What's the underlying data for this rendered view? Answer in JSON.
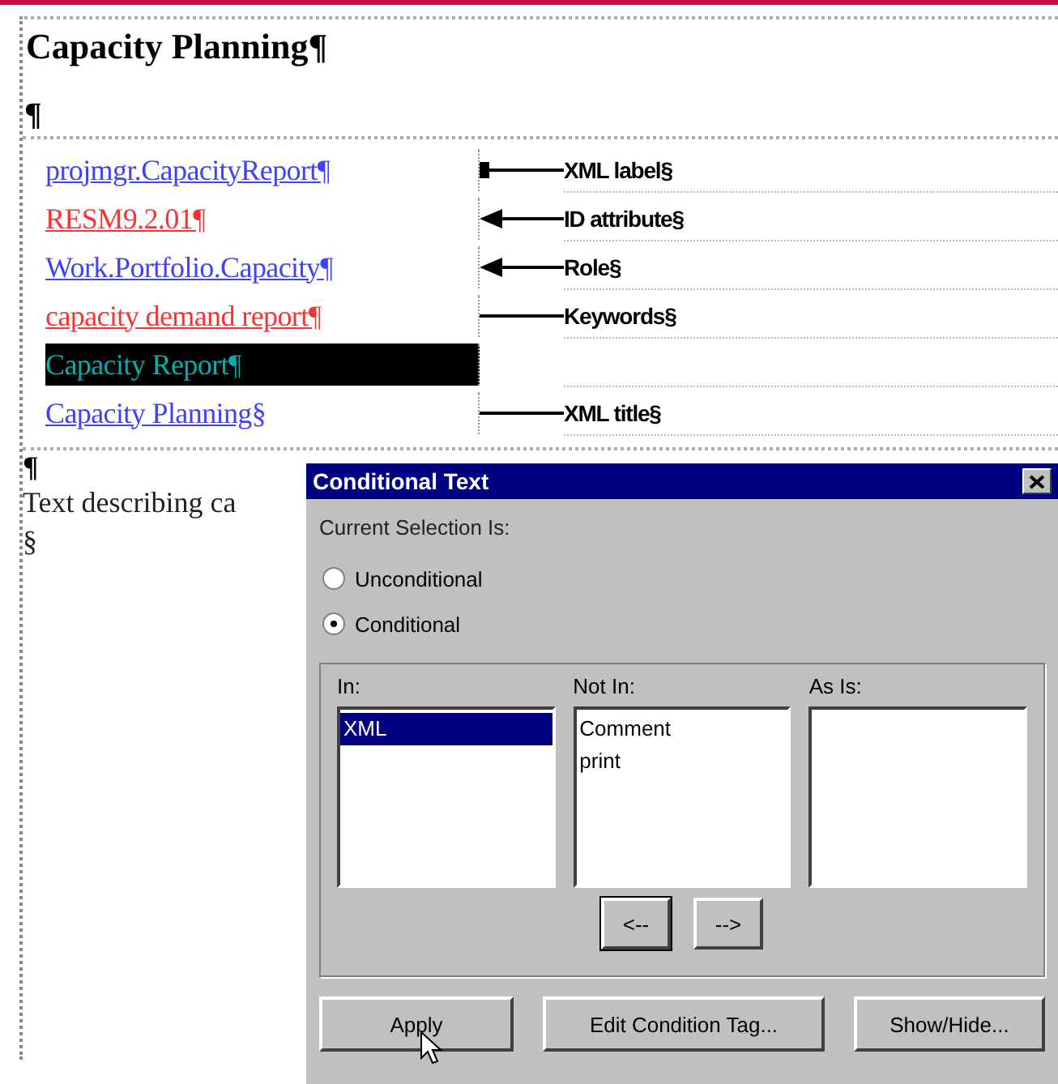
{
  "document": {
    "heading": "Capacity Planning¶",
    "empty_paragraph": "¶",
    "rows": [
      {
        "text": "projmgr.CapacityReport¶",
        "color": "#4040ff",
        "selected": false,
        "label": "XML label§",
        "kind": "dot"
      },
      {
        "text": "RESM9.2.01¶",
        "color": "#ff3030",
        "selected": false,
        "label": "ID attribute§",
        "kind": "arrow"
      },
      {
        "text": "Work.Portfolio.Capacity¶",
        "color": "#4040ff",
        "selected": false,
        "label": "Role§",
        "kind": "arrow"
      },
      {
        "text": "capacity demand report¶",
        "color": "#ff3030",
        "selected": false,
        "label": "Keywords§",
        "kind": "line"
      },
      {
        "text": "Capacity Report¶",
        "color": "#00b0b0",
        "selected": true,
        "label": "",
        "kind": "none"
      },
      {
        "text": "Capacity Planning§",
        "color": "#4040ff",
        "selected": false,
        "label": "XML title§",
        "kind": "line"
      }
    ],
    "after_table_mark": "¶",
    "body_text": "Text describing ca",
    "end_mark": "§"
  },
  "dialog": {
    "title": "Conditional Text",
    "selection_label": "Current Selection Is:",
    "radios": [
      {
        "label": "Unconditional",
        "selected": false
      },
      {
        "label": "Conditional",
        "selected": true
      }
    ],
    "lists": [
      {
        "heading": "In:",
        "items": [
          {
            "label": "XML",
            "selected": true
          }
        ]
      },
      {
        "heading": "Not In:",
        "items": [
          {
            "label": "Comment",
            "selected": false
          },
          {
            "label": "print",
            "selected": false
          }
        ]
      },
      {
        "heading": "As Is:"
      }
    ],
    "move_buttons": [
      {
        "label": "<--",
        "focused": true
      },
      {
        "label": "-->",
        "focused": false
      }
    ],
    "buttons": [
      "Apply",
      "Edit Condition Tag...",
      "Show/Hide..."
    ]
  }
}
